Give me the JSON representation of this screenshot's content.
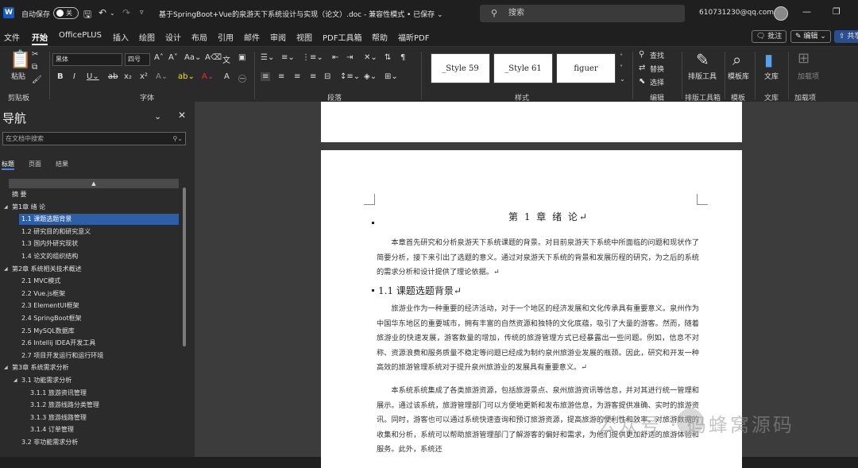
{
  "titlebar": {
    "autosave_label": "自动保存",
    "autosave_state": "关",
    "document_title": "基于SpringBoot+Vue的泉游天下系统设计与实现（论文）.doc - 兼容性模式 • 已保存 ⌄",
    "search_placeholder": "搜索",
    "account": "610731230@qq.com"
  },
  "menu": {
    "items": [
      "文件",
      "开始",
      "OfficePLUS",
      "插入",
      "绘图",
      "设计",
      "布局",
      "引用",
      "邮件",
      "审阅",
      "视图",
      "PDF工具箱",
      "帮助",
      "福昕PDF"
    ],
    "active": "开始",
    "comment_btn": "批注",
    "edit_btn": "编辑",
    "share_btn": "共享"
  },
  "ribbon": {
    "paste_label": "粘贴",
    "clipboard_group": "剪贴板",
    "font_name": "黑体",
    "font_size": "四号",
    "font_group": "字体",
    "paragraph_group": "段落",
    "styles": [
      "_Style 59",
      "_Style 61",
      "figuer"
    ],
    "styles_group": "样式",
    "find_label": "查找",
    "replace_label": "替换",
    "select_label": "选择",
    "edit_group": "编辑",
    "layout_tool": "排版工具",
    "layout_tool_group": "排版工具箱",
    "template_lib": "模板库",
    "template_group": "模板",
    "wenku": "文库",
    "wenku_group": "文库",
    "addins": "加载项",
    "addins_group": "加载项"
  },
  "nav": {
    "title": "导航",
    "search_placeholder": "在文档中搜索",
    "tabs": [
      "标题",
      "页面",
      "结果"
    ],
    "headings": [
      {
        "text": "摘  要",
        "level": 1,
        "tri": false
      },
      {
        "text": "第1章 绪 论",
        "level": 1,
        "tri": true
      },
      {
        "text": "1.1 课题选题背景",
        "level": 2,
        "selected": true
      },
      {
        "text": "1.2 研究目的和研究意义",
        "level": 2
      },
      {
        "text": "1.3 国内外研究现状",
        "level": 2
      },
      {
        "text": "1.4 论文的组织结构",
        "level": 2
      },
      {
        "text": "第2章 系统相关技术概述",
        "level": 1,
        "tri": true
      },
      {
        "text": "2.1 MVC模式",
        "level": 2
      },
      {
        "text": "2.2 Vue.js框架",
        "level": 2
      },
      {
        "text": "2.3 ElementUI框架",
        "level": 2
      },
      {
        "text": "2.4 SpringBoot框架",
        "level": 2
      },
      {
        "text": "2.5 MySQL数据库",
        "level": 2
      },
      {
        "text": "2.6 Intellij IDEA开发工具",
        "level": 2
      },
      {
        "text": "2.7 项目开发运行和运行环境",
        "level": 2
      },
      {
        "text": "第3章 系统需求分析",
        "level": 1,
        "tri": true
      },
      {
        "text": "3.1 功能需求分析",
        "level": 2,
        "tri": true
      },
      {
        "text": "3.1.1 旅游资讯管理",
        "level": 3
      },
      {
        "text": "3.1.2 旅游线路分类管理",
        "level": 3
      },
      {
        "text": "3.1.3 旅游线路管理",
        "level": 3
      },
      {
        "text": "3.1.4 订单管理",
        "level": 3
      },
      {
        "text": "3.2 非功能需求分析",
        "level": 2
      }
    ]
  },
  "document": {
    "chapter_title": "第 1 章   绪   论↵",
    "intro": "本章首先研究和分析泉游天下系统课题的背景。对目前泉游天下系统中所面临的问题和现状作了简要分析，接下来引出了选题的意义。通过对泉游天下系统的背景和发展历程的研究，为之后的系统的需求分析和设计提供了理论依据。↵",
    "section_title": "1.1   课题选题背景↵",
    "para1": "旅游业作为一种重要的经济活动，对于一个地区的经济发展和文化传承具有重要意义。泉州作为中国华东地区的重要城市，拥有丰富的自然资源和独特的文化底蕴，吸引了大量的游客。然而，随着旅游业的快速发展，游客数量的增加，传统的旅游管理方式已经暴露出一些问题。例如，信息不对称、资源浪费和服务质量不稳定等问题已经成为制约泉州旅游业发展的瓶颈。因此，研究和开发一种高效的旅游管理系统对于提升泉州旅游业的发展具有重要意义。↵",
    "para2": "本系统系统集成了各类旅游资源，包括旅游景点、泉州旅游资讯等信息，并对其进行统一管理和展示。通过该系统，旅游管理部门可以方便地更新和发布旅游信息，为游客提供准确、实时的旅游资讯。同时，游客也可以通过系统快速查询和预订旅游资源，提高旅游的便利性和效率。对旅游数据的收集和分析，系统可以帮助旅游管理部门了解游客的偏好和需求，为他们提供更加舒适的旅游体验和服务。此外，系统还"
  },
  "watermark": "公众号 · 码蜂窝源码"
}
